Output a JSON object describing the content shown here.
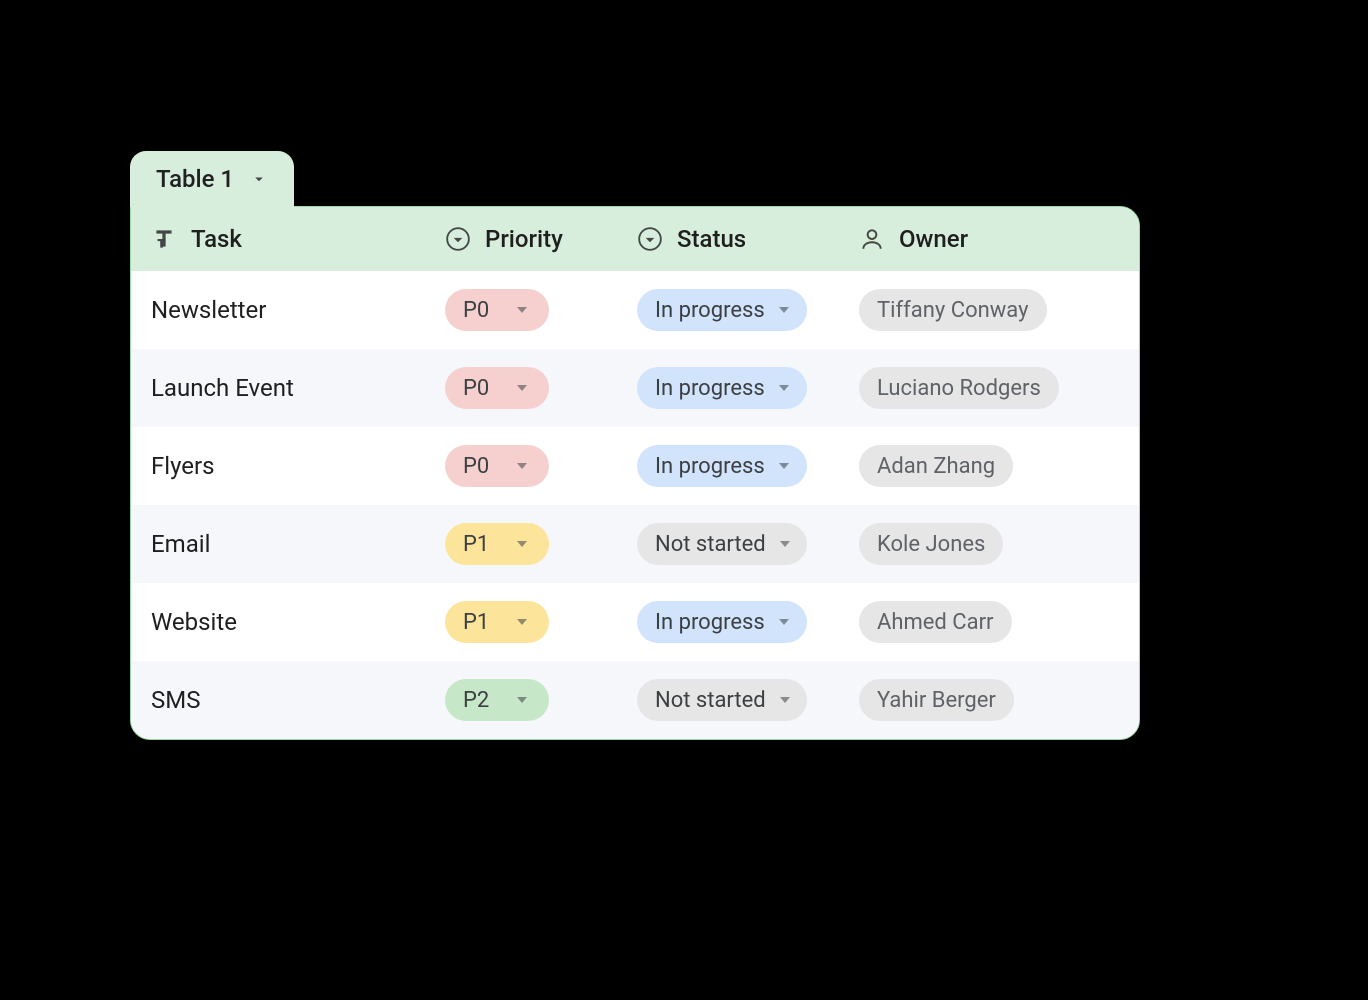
{
  "tab": {
    "label": "Table 1"
  },
  "columns": {
    "task": "Task",
    "priority": "Priority",
    "status": "Status",
    "owner": "Owner"
  },
  "priority_colors": {
    "P0": "pill-p0",
    "P1": "pill-p1",
    "P2": "pill-p2"
  },
  "status_colors": {
    "In progress": "pill-inprog",
    "Not started": "pill-notstarted"
  },
  "rows": [
    {
      "task": "Newsletter",
      "priority": "P0",
      "status": "In progress",
      "owner": "Tiffany Conway"
    },
    {
      "task": "Launch Event",
      "priority": "P0",
      "status": "In progress",
      "owner": "Luciano Rodgers"
    },
    {
      "task": "Flyers",
      "priority": "P0",
      "status": "In progress",
      "owner": "Adan Zhang"
    },
    {
      "task": "Email",
      "priority": "P1",
      "status": "Not started",
      "owner": "Kole Jones"
    },
    {
      "task": "Website",
      "priority": "P1",
      "status": "In progress",
      "owner": "Ahmed Carr"
    },
    {
      "task": "SMS",
      "priority": "P2",
      "status": "Not started",
      "owner": "Yahir Berger"
    }
  ]
}
